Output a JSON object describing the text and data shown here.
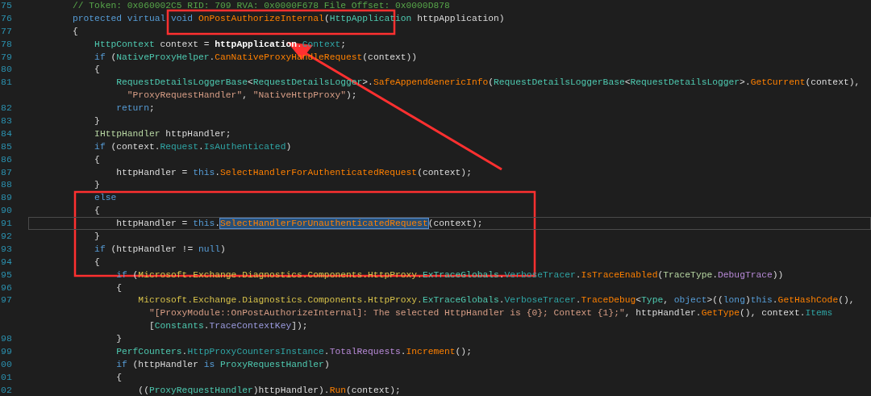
{
  "editor": {
    "lines": [
      {
        "number": "75",
        "tokens": [
          {
            "kind": "comment",
            "text": "// Token: 0x060002C5 RID: 709 RVA: 0x0000F678 File Offset: 0x0000D878"
          }
        ]
      },
      {
        "number": "76",
        "tokens": [
          {
            "kind": "keyword",
            "text": "protected virtual void "
          },
          {
            "kind": "method",
            "text": "OnPostAuthorizeInternal"
          },
          {
            "kind": "plain",
            "text": "("
          },
          {
            "kind": "type",
            "text": "HttpApplication"
          },
          {
            "kind": "plain",
            "text": " httpApplication)"
          }
        ]
      },
      {
        "number": "77",
        "tokens": [
          {
            "kind": "plain",
            "text": "{"
          }
        ]
      },
      {
        "number": "78",
        "tokens": [
          {
            "kind": "type",
            "text": "    HttpContext"
          },
          {
            "kind": "plain",
            "text": " context = "
          },
          {
            "kind": "param",
            "text": "httpApplication"
          },
          {
            "kind": "plain",
            "text": "."
          },
          {
            "kind": "property",
            "text": "Context"
          },
          {
            "kind": "plain",
            "text": ";"
          }
        ]
      },
      {
        "number": "79",
        "tokens": [
          {
            "kind": "keyword",
            "text": "    if"
          },
          {
            "kind": "plain",
            "text": " ("
          },
          {
            "kind": "type",
            "text": "NativeProxyHelper"
          },
          {
            "kind": "plain",
            "text": "."
          },
          {
            "kind": "method",
            "text": "CanNativeProxyHandleRequest"
          },
          {
            "kind": "plain",
            "text": "(context))"
          }
        ]
      },
      {
        "number": "80",
        "tokens": [
          {
            "kind": "plain",
            "text": "    {"
          }
        ]
      },
      {
        "number": "81",
        "tokens": [
          {
            "kind": "type",
            "text": "        RequestDetailsLoggerBase"
          },
          {
            "kind": "plain",
            "text": "<"
          },
          {
            "kind": "type",
            "text": "RequestDetailsLogger"
          },
          {
            "kind": "plain",
            "text": ">."
          },
          {
            "kind": "method",
            "text": "SafeAppendGenericInfo"
          },
          {
            "kind": "plain",
            "text": "("
          },
          {
            "kind": "type",
            "text": "RequestDetailsLoggerBase"
          },
          {
            "kind": "plain",
            "text": "<"
          },
          {
            "kind": "type",
            "text": "RequestDetailsLogger"
          },
          {
            "kind": "plain",
            "text": ">."
          },
          {
            "kind": "method",
            "text": "GetCurrent"
          },
          {
            "kind": "plain",
            "text": "(context),"
          }
        ]
      },
      {
        "tokens": [
          {
            "kind": "string",
            "text": "          \"ProxyRequestHandler\""
          },
          {
            "kind": "plain",
            "text": ", "
          },
          {
            "kind": "string",
            "text": "\"NativeHttpProxy\""
          },
          {
            "kind": "plain",
            "text": ");"
          }
        ]
      },
      {
        "number": "82",
        "tokens": [
          {
            "kind": "keyword",
            "text": "        return"
          },
          {
            "kind": "plain",
            "text": ";"
          }
        ]
      },
      {
        "number": "83",
        "tokens": [
          {
            "kind": "plain",
            "text": "    }"
          }
        ]
      },
      {
        "number": "84",
        "tokens": [
          {
            "kind": "interface",
            "text": "    IHttpHandler"
          },
          {
            "kind": "plain",
            "text": " httpHandler;"
          }
        ]
      },
      {
        "number": "85",
        "tokens": [
          {
            "kind": "keyword",
            "text": "    if"
          },
          {
            "kind": "plain",
            "text": " (context."
          },
          {
            "kind": "property",
            "text": "Request"
          },
          {
            "kind": "plain",
            "text": "."
          },
          {
            "kind": "property",
            "text": "IsAuthenticated"
          },
          {
            "kind": "plain",
            "text": ")"
          }
        ]
      },
      {
        "number": "86",
        "tokens": [
          {
            "kind": "plain",
            "text": "    {"
          }
        ]
      },
      {
        "number": "87",
        "tokens": [
          {
            "kind": "plain",
            "text": "        httpHandler = "
          },
          {
            "kind": "keyword",
            "text": "this"
          },
          {
            "kind": "plain",
            "text": "."
          },
          {
            "kind": "method",
            "text": "SelectHandlerForAuthenticatedRequest"
          },
          {
            "kind": "plain",
            "text": "(context);"
          }
        ]
      },
      {
        "number": "88",
        "tokens": [
          {
            "kind": "plain",
            "text": "    }"
          }
        ]
      },
      {
        "number": "89",
        "tokens": [
          {
            "kind": "keyword",
            "text": "    else"
          }
        ]
      },
      {
        "number": "90",
        "tokens": [
          {
            "kind": "plain",
            "text": "    {"
          }
        ]
      },
      {
        "number": "91",
        "current": true,
        "tokens": [
          {
            "kind": "plain",
            "text": "        httpHandler = "
          },
          {
            "kind": "keyword",
            "text": "this"
          },
          {
            "kind": "plain",
            "text": "."
          },
          {
            "kind": "method",
            "text": "SelectHandlerForUnauthenticatedRequest",
            "selected": true
          },
          {
            "kind": "plain",
            "text": "(context);"
          }
        ]
      },
      {
        "number": "92",
        "tokens": [
          {
            "kind": "plain",
            "text": "    }"
          }
        ]
      },
      {
        "number": "93",
        "tokens": [
          {
            "kind": "keyword",
            "text": "    if"
          },
          {
            "kind": "plain",
            "text": " (httpHandler != "
          },
          {
            "kind": "keyword",
            "text": "null"
          },
          {
            "kind": "plain",
            "text": ")"
          }
        ]
      },
      {
        "number": "94",
        "tokens": [
          {
            "kind": "plain",
            "text": "    {"
          }
        ]
      },
      {
        "number": "95",
        "tokens": [
          {
            "kind": "keyword",
            "text": "        if"
          },
          {
            "kind": "plain",
            "text": " ("
          },
          {
            "kind": "namespace",
            "text": "Microsoft.Exchange.Diagnostics.Components.HttpProxy."
          },
          {
            "kind": "type",
            "text": "ExTraceGlobals"
          },
          {
            "kind": "plain",
            "text": "."
          },
          {
            "kind": "property",
            "text": "VerboseTracer"
          },
          {
            "kind": "plain",
            "text": "."
          },
          {
            "kind": "method",
            "text": "IsTraceEnabled"
          },
          {
            "kind": "plain",
            "text": "("
          },
          {
            "kind": "enumtype",
            "text": "TraceType"
          },
          {
            "kind": "plain",
            "text": "."
          },
          {
            "kind": "enum",
            "text": "DebugTrace"
          },
          {
            "kind": "plain",
            "text": "))"
          }
        ]
      },
      {
        "number": "96",
        "tokens": [
          {
            "kind": "plain",
            "text": "        {"
          }
        ]
      },
      {
        "number": "97",
        "tokens": [
          {
            "kind": "namespace",
            "text": "            Microsoft.Exchange.Diagnostics.Components.HttpProxy."
          },
          {
            "kind": "type",
            "text": "ExTraceGlobals"
          },
          {
            "kind": "plain",
            "text": "."
          },
          {
            "kind": "property",
            "text": "VerboseTracer"
          },
          {
            "kind": "plain",
            "text": "."
          },
          {
            "kind": "method",
            "text": "TraceDebug"
          },
          {
            "kind": "plain",
            "text": "<"
          },
          {
            "kind": "type",
            "text": "Type"
          },
          {
            "kind": "plain",
            "text": ", "
          },
          {
            "kind": "keyword",
            "text": "object"
          },
          {
            "kind": "plain",
            "text": ">(("
          },
          {
            "kind": "keyword",
            "text": "long"
          },
          {
            "kind": "plain",
            "text": ")"
          },
          {
            "kind": "keyword",
            "text": "this"
          },
          {
            "kind": "plain",
            "text": "."
          },
          {
            "kind": "method",
            "text": "GetHashCode"
          },
          {
            "kind": "plain",
            "text": "(),"
          }
        ]
      },
      {
        "tokens": [
          {
            "kind": "string",
            "text": "              \"[ProxyModule::OnPostAuthorizeInternal]: The selected HttpHandler is {0}; Context {1};\""
          },
          {
            "kind": "plain",
            "text": ", httpHandler."
          },
          {
            "kind": "method",
            "text": "GetType"
          },
          {
            "kind": "plain",
            "text": "(), context."
          },
          {
            "kind": "property",
            "text": "Items"
          }
        ]
      },
      {
        "tokens": [
          {
            "kind": "plain",
            "text": "              ["
          },
          {
            "kind": "type",
            "text": "Constants"
          },
          {
            "kind": "plain",
            "text": "."
          },
          {
            "kind": "field",
            "text": "TraceContextKey"
          },
          {
            "kind": "plain",
            "text": "]);"
          }
        ]
      },
      {
        "number": "98",
        "tokens": [
          {
            "kind": "plain",
            "text": "        }"
          }
        ]
      },
      {
        "number": "99",
        "tokens": [
          {
            "kind": "type",
            "text": "        PerfCounters"
          },
          {
            "kind": "plain",
            "text": "."
          },
          {
            "kind": "property",
            "text": "HttpProxyCountersInstance"
          },
          {
            "kind": "plain",
            "text": "."
          },
          {
            "kind": "enum",
            "text": "TotalRequests"
          },
          {
            "kind": "plain",
            "text": "."
          },
          {
            "kind": "method",
            "text": "Increment"
          },
          {
            "kind": "plain",
            "text": "();"
          }
        ]
      },
      {
        "number": "00",
        "tokens": [
          {
            "kind": "keyword",
            "text": "        if"
          },
          {
            "kind": "plain",
            "text": " (httpHandler "
          },
          {
            "kind": "keyword",
            "text": "is "
          },
          {
            "kind": "type",
            "text": "ProxyRequestHandler"
          },
          {
            "kind": "plain",
            "text": ")"
          }
        ]
      },
      {
        "number": "01",
        "tokens": [
          {
            "kind": "plain",
            "text": "        {"
          }
        ]
      },
      {
        "number": "02",
        "tokens": [
          {
            "kind": "plain",
            "text": "            (("
          },
          {
            "kind": "type",
            "text": "ProxyRequestHandler"
          },
          {
            "kind": "plain",
            "text": ")httpHandler)."
          },
          {
            "kind": "method",
            "text": "Run"
          },
          {
            "kind": "plain",
            "text": "(context);"
          }
        ]
      }
    ]
  }
}
